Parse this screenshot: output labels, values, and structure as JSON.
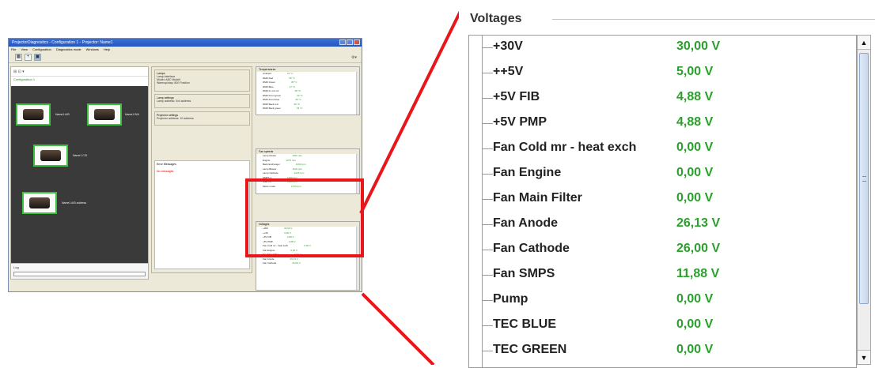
{
  "mini_window": {
    "title": "ProjectorDiagnostics - Configuration 1 - Projector: Name1",
    "menu": [
      "File",
      "View",
      "Configuration",
      "Diagnostics mode",
      "Windows",
      "Help"
    ],
    "tab": "Configuration 1",
    "devices": [
      "Name1 A/B",
      "Name1 B/A",
      "Name1 C/D",
      "Name1 A/B address"
    ],
    "status_label": "Log",
    "mid_groups": [
      {
        "title": "Lamps",
        "lines": [
          "Lamp interface",
          "Model: ABC Modell",
          "Warmup/stay: 800 Position"
        ]
      },
      {
        "title": "Lamp settings",
        "lines": [
          "Lamp address: 0x4 address"
        ]
      },
      {
        "title": "Projector settings",
        "lines": [
          "Projector address: 10 address"
        ]
      }
    ],
    "error_box_title": "Error Messages",
    "error_box_text": "No messages",
    "right_groups": [
      {
        "title": "Temperatures",
        "rows": [
          [
            "Ambient",
            "31 °C"
          ],
          [
            "DMD Red",
            "36 °C"
          ],
          [
            "DMD Green",
            "35 °C"
          ],
          [
            "DMD Blue",
            "37 °C"
          ],
          [
            "DMD Fr ont mir",
            "38 °C"
          ],
          [
            "DMD Front green",
            "34 °C"
          ],
          [
            "DMD Front blue",
            "36 °C"
          ],
          [
            "DMD Back red",
            "35 °C"
          ],
          [
            "DMD Back green",
            "33 °C"
          ]
        ]
      },
      {
        "title": "Fan speeds",
        "rows": [
          [
            "Lamp blower",
            "1230 rpm"
          ],
          [
            "Engine",
            "1275 rpm"
          ],
          [
            "Back Exchanger",
            "1260 rpm"
          ],
          [
            "Lamp Blower",
            "1100 rpm"
          ],
          [
            "Lamp Cathode",
            "1225 rpm"
          ],
          [
            "SMPS 1",
            "1200 rpm"
          ],
          [
            "SMPS 2",
            "1200 rpm"
          ],
          [
            "Motor mode",
            "1270 rpm"
          ]
        ]
      },
      {
        "title": "Voltages",
        "rows": [
          [
            "+30V",
            "30,00 V"
          ],
          [
            "++5V",
            "5,00 V"
          ],
          [
            "+5V FIB",
            "4,88 V"
          ],
          [
            "+5V PMP",
            "4,88 V"
          ],
          [
            "Fan Cold mr - heat exch",
            "0,00 V"
          ],
          [
            "Fan Engine",
            "0,00 V"
          ],
          [
            "Fan Main Filter",
            "0,00 V"
          ],
          [
            "Fan Anode",
            "26,13 V"
          ],
          [
            "Fan Cathode",
            "26,00 V"
          ]
        ]
      }
    ]
  },
  "voltages_panel": {
    "title": "Voltages",
    "items": [
      {
        "name": "+30V",
        "value": "30,00 V"
      },
      {
        "name": "++5V",
        "value": "5,00 V"
      },
      {
        "name": "+5V FIB",
        "value": "4,88 V"
      },
      {
        "name": "+5V PMP",
        "value": "4,88 V"
      },
      {
        "name": "Fan Cold mr - heat exch",
        "value": "0,00 V"
      },
      {
        "name": "Fan Engine",
        "value": "0,00 V"
      },
      {
        "name": "Fan Main Filter",
        "value": "0,00 V"
      },
      {
        "name": "Fan Anode",
        "value": "26,13 V"
      },
      {
        "name": "Fan Cathode",
        "value": "26,00 V"
      },
      {
        "name": "Fan SMPS",
        "value": "11,88 V"
      },
      {
        "name": "Pump",
        "value": "0,00 V"
      },
      {
        "name": "TEC BLUE",
        "value": "0,00 V"
      },
      {
        "name": "TEC GREEN",
        "value": "0,00 V"
      }
    ],
    "scroll_up_icon": "▲",
    "scroll_down_icon": "▼"
  },
  "colors": {
    "value_green": "#2ca02c",
    "highlight_red": "#e8161b",
    "device_border": "#3fbf3f"
  }
}
